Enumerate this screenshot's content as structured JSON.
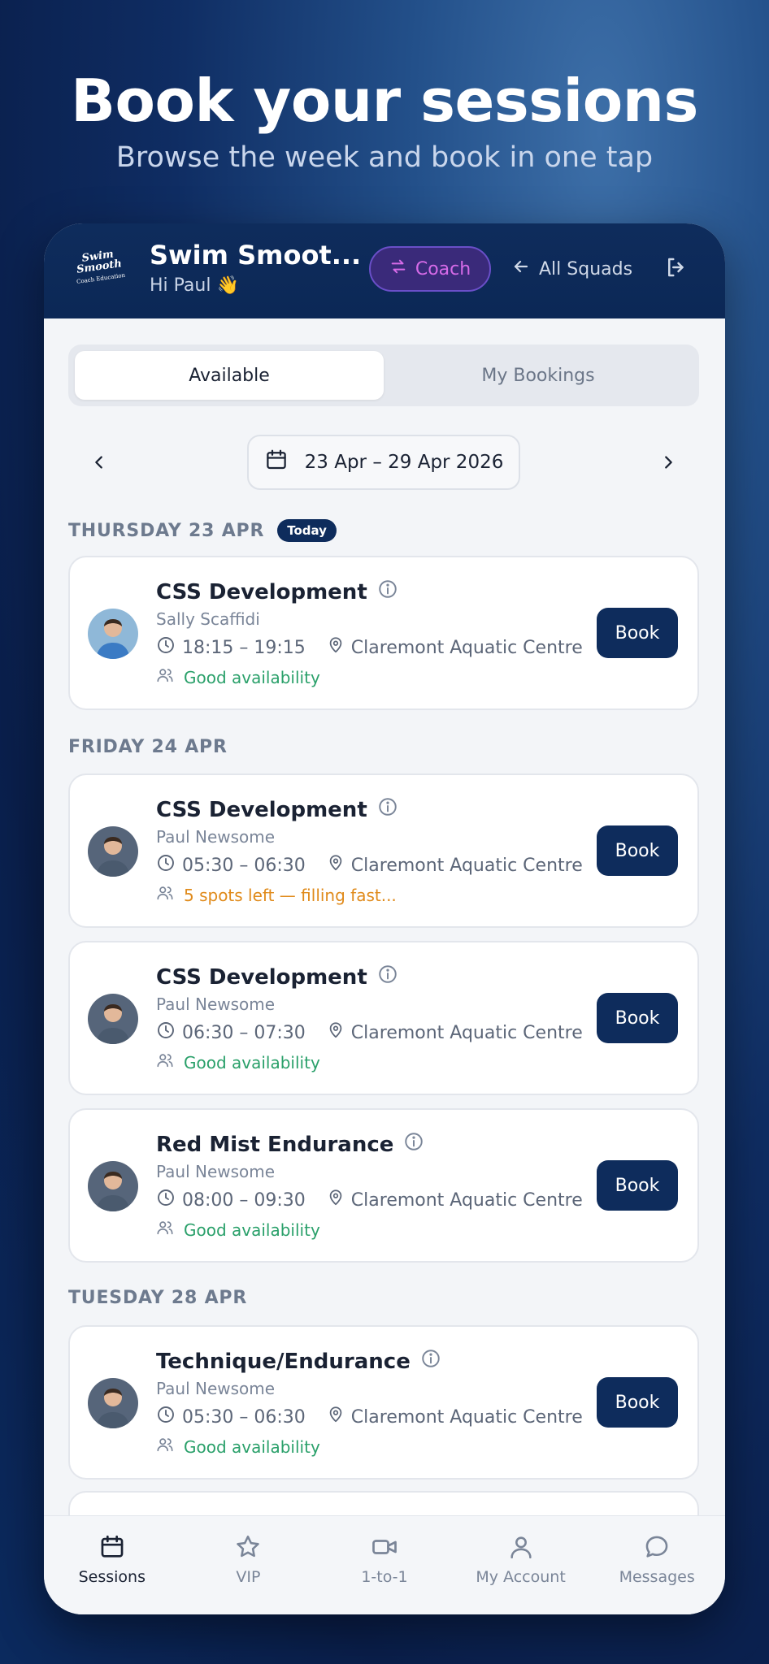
{
  "hero": {
    "title": "Book your sessions",
    "subtitle": "Browse the week and book in one tap"
  },
  "header": {
    "logo_line1": "Swim",
    "logo_line2": "Smooth",
    "logo_line3": "Coach Education",
    "club_name": "Swim Smoot...",
    "greeting": "Hi Paul 👋",
    "coach_label": "Coach",
    "all_squads_label": "All Squads"
  },
  "tabs": {
    "available": "Available",
    "my_bookings": "My Bookings",
    "active": "available"
  },
  "week": {
    "range": "23 Apr – 29 Apr 2026"
  },
  "days": [
    {
      "heading": "THURSDAY 23 APR",
      "badge": "Today",
      "sessions": [
        {
          "title": "CSS Development",
          "coach": "Sally Scaffidi",
          "time": "18:15 – 19:15",
          "location": "Claremont Aquatic Centre",
          "availability": "Good availability",
          "availability_level": "good",
          "book_label": "Book"
        }
      ]
    },
    {
      "heading": "FRIDAY 24 APR",
      "sessions": [
        {
          "title": "CSS Development",
          "coach": "Paul Newsome",
          "time": "05:30 – 06:30",
          "location": "Claremont Aquatic Centre",
          "availability": "5 spots left — filling fast...",
          "availability_level": "low",
          "book_label": "Book"
        },
        {
          "title": "CSS Development",
          "coach": "Paul Newsome",
          "time": "06:30 – 07:30",
          "location": "Claremont Aquatic Centre",
          "availability": "Good availability",
          "availability_level": "good",
          "book_label": "Book"
        },
        {
          "title": "Red Mist Endurance",
          "coach": "Paul Newsome",
          "time": "08:00 – 09:30",
          "location": "Claremont Aquatic Centre",
          "availability": "Good availability",
          "availability_level": "good",
          "book_label": "Book"
        }
      ]
    },
    {
      "heading": "TUESDAY 28 APR",
      "sessions": [
        {
          "title": "Technique/Endurance",
          "coach": "Paul Newsome",
          "time": "05:30 – 06:30",
          "location": "Claremont Aquatic Centre",
          "availability": "Good availability",
          "availability_level": "good",
          "book_label": "Book"
        }
      ]
    }
  ],
  "bottom_nav": [
    {
      "label": "Sessions",
      "icon": "calendar-icon",
      "active": true
    },
    {
      "label": "VIP",
      "icon": "star-icon",
      "active": false
    },
    {
      "label": "1-to-1",
      "icon": "video-icon",
      "active": false
    },
    {
      "label": "My Account",
      "icon": "user-icon",
      "active": false
    },
    {
      "label": "Messages",
      "icon": "chat-icon",
      "active": false
    }
  ],
  "colors": {
    "primary": "#0e2c5c",
    "coach_accent": "#d66be8",
    "available_green": "#2aa06a",
    "low_orange": "#e08a1a"
  }
}
